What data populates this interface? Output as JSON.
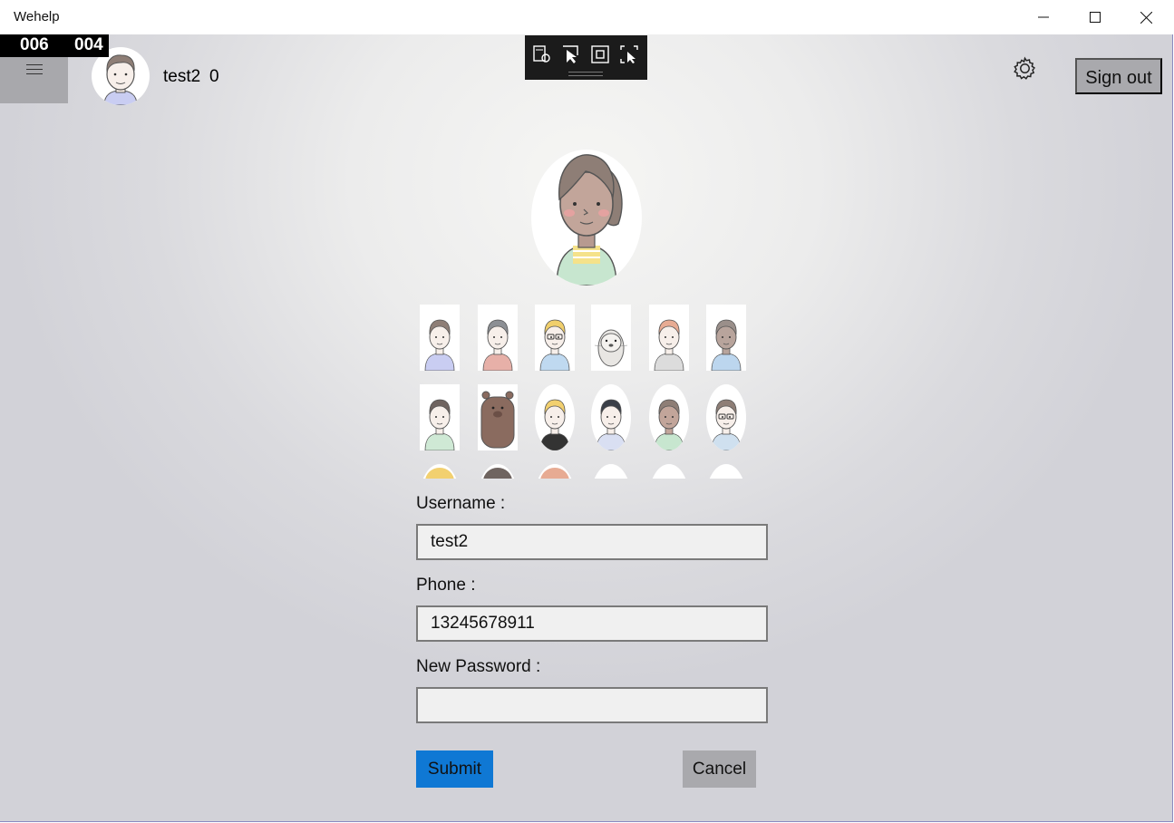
{
  "window": {
    "title": "Wehelp",
    "minimize_icon": "minimize-icon",
    "maximize_icon": "maximize-icon",
    "close_icon": "close-icon"
  },
  "overlay_counter": {
    "left": "006",
    "right": "004"
  },
  "header": {
    "menu_icon": "hamburger-icon",
    "username": "test2",
    "score": "0",
    "settings_icon": "gear-icon",
    "sign_out_label": "Sign out"
  },
  "debug_toolbar": {
    "icons": [
      "select-element-icon",
      "pointer-icon",
      "layout-bounds-icon",
      "track-focus-icon"
    ]
  },
  "avatar_picker": {
    "selected": "woman-ponytail",
    "rows": [
      [
        "man-brown-hair",
        "man-gray-hair",
        "man-glasses-blond",
        "otter",
        "man-red-hair",
        "man-bald"
      ],
      [
        "man-dark-hair",
        "bear",
        "woman-blonde",
        "woman-black-hair",
        "woman-ponytail",
        "woman-glasses"
      ]
    ]
  },
  "form": {
    "username_label": "Username :",
    "username_value": "test2",
    "phone_label": "Phone :",
    "phone_value": "13245678911",
    "password_label": "New Password :",
    "password_value": "",
    "submit_label": "Submit",
    "cancel_label": "Cancel"
  }
}
